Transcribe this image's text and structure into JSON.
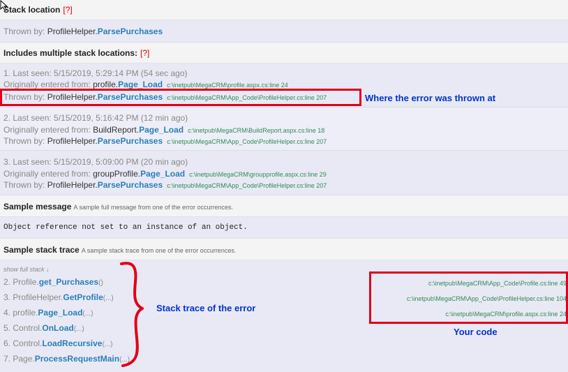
{
  "stack_location": {
    "title": "Stack location",
    "help": "[?]",
    "thrown_by_label": "Thrown by:",
    "thrown_by_class": "ProfileHelper.",
    "thrown_by_method": "ParsePurchases"
  },
  "multiple": {
    "title": "Includes multiple stack locations:",
    "help": "[?]",
    "entries": [
      {
        "seen": "1. Last seen: 5/15/2019, 5:29:14 PM (54 sec ago)",
        "entered_label": "Originally entered from:",
        "entered_class": "profile.",
        "entered_method": "Page_Load",
        "entered_path": "c:\\inetpub\\MegaCRM\\profile.aspx.cs:line 24",
        "thrown_label": "Thrown by:",
        "thrown_class": "ProfileHelper.",
        "thrown_method": "ParsePurchases",
        "thrown_path": "c:\\inetpub\\MegaCRM\\App_Code\\ProfileHelper.cs:line 207"
      },
      {
        "seen": "2. Last seen: 5/15/2019, 5:16:42 PM (12 min ago)",
        "entered_label": "Originally entered from:",
        "entered_class": "BuildReport.",
        "entered_method": "Page_Load",
        "entered_path": "c:\\inetpub\\MegaCRM\\BuildReport.aspx.cs:line 18",
        "thrown_label": "Thrown by:",
        "thrown_class": "ProfileHelper.",
        "thrown_method": "ParsePurchases",
        "thrown_path": "c:\\inetpub\\MegaCRM\\App_Code\\ProfileHelper.cs:line 207"
      },
      {
        "seen": "3. Last seen: 5/15/2019, 5:09:00 PM (20 min ago)",
        "entered_label": "Originally entered from:",
        "entered_class": "groupProfile.",
        "entered_method": "Page_Load",
        "entered_path": "c:\\inetpub\\MegaCRM\\groupprofile.aspx.cs:line 29",
        "thrown_label": "Thrown by:",
        "thrown_class": "ProfileHelper.",
        "thrown_method": "ParsePurchases",
        "thrown_path": "c:\\inetpub\\MegaCRM\\App_Code\\ProfileHelper.cs:line 207"
      }
    ]
  },
  "sample_message": {
    "title": "Sample message",
    "desc": "A sample full message from one of the error occurrences.",
    "text": "Object reference not set to an instance of an object."
  },
  "sample_stack": {
    "title": "Sample stack trace",
    "desc": "A sample stack trace from one of the error occurrences.",
    "show_full": "show full stack ↓",
    "frames": [
      {
        "num": "2.",
        "cls": "Profile.",
        "method": "get_Purchases",
        "args": "()"
      },
      {
        "num": "3.",
        "cls": "ProfileHelper.",
        "method": "GetProfile",
        "args": "(...)"
      },
      {
        "num": "4.",
        "cls": "profile.",
        "method": "Page_Load",
        "args": "(...)"
      },
      {
        "num": "5.",
        "cls": "Control.",
        "method": "OnLoad",
        "args": "(...)"
      },
      {
        "num": "6.",
        "cls": "Control.",
        "method": "LoadRecursive",
        "args": "(...)"
      },
      {
        "num": "7.",
        "cls": "Page.",
        "method": "ProcessRequestMain",
        "args": "(...)"
      }
    ],
    "paths": [
      "c:\\inetpub\\MegaCRM\\App_Code\\Profile.cs:line 49",
      "c:\\inetpub\\MegaCRM\\App_Code\\ProfileHelper.cs:line 104",
      "c:\\inetpub\\MegaCRM\\profile.aspx.cs:line 24"
    ]
  },
  "annotations": {
    "thrown_at": "Where the error was thrown at",
    "stack_trace": "Stack trace of the error",
    "your_code": "Your code"
  },
  "colors": {
    "method_link": "#2a7fb8",
    "path_green": "#2e8b57",
    "annotation_red": "#e00018",
    "annotation_blue": "#0033cc"
  }
}
